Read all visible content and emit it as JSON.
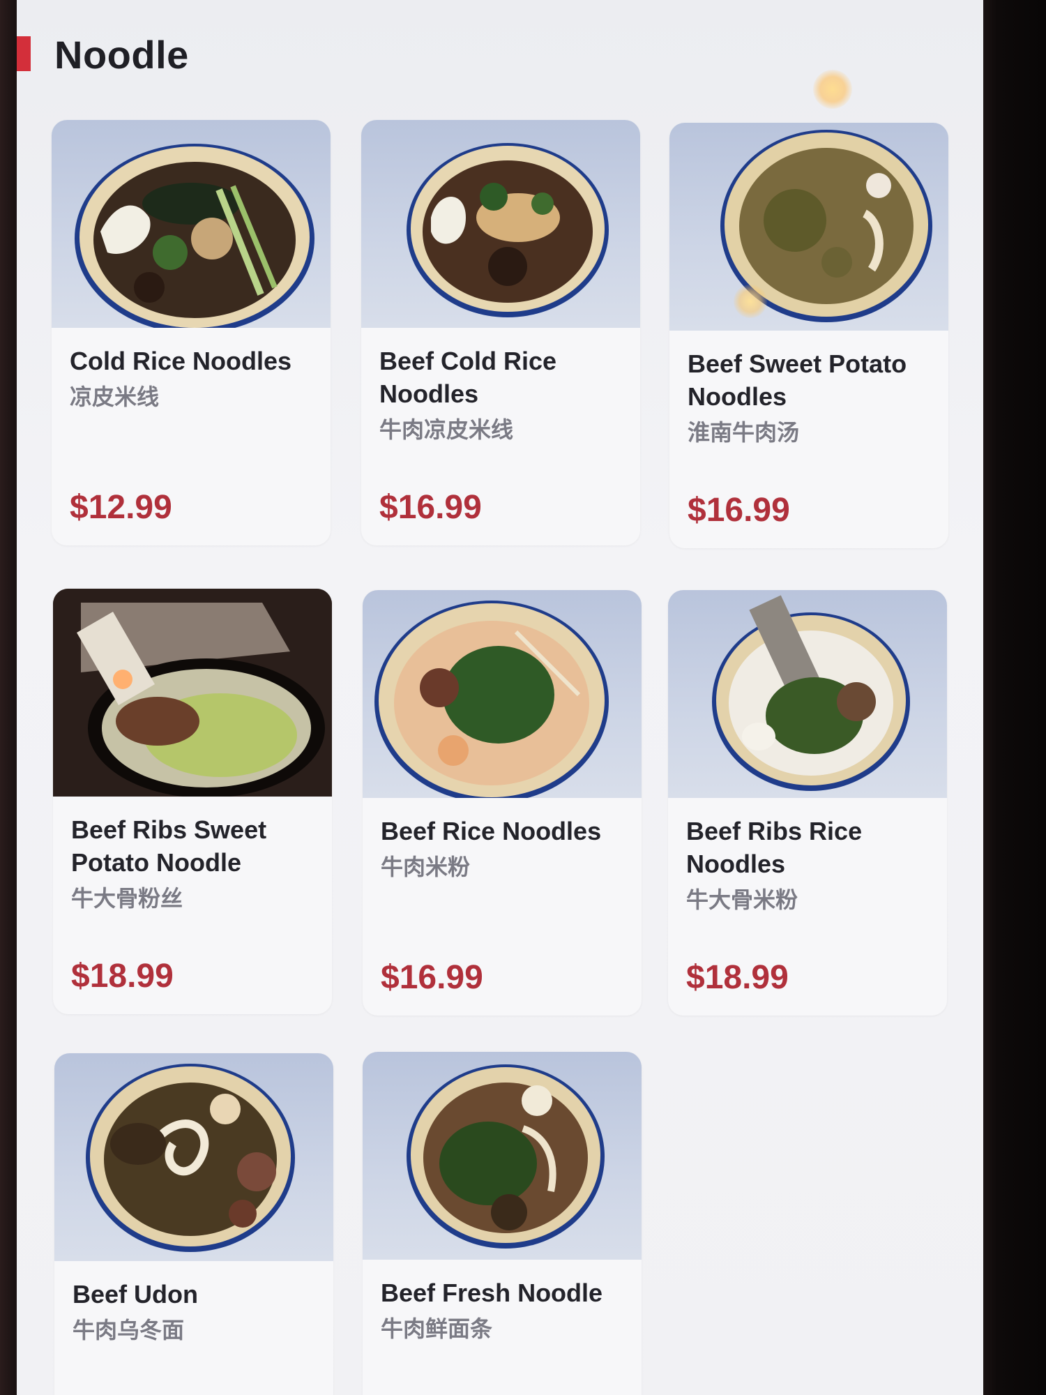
{
  "section": {
    "title": "Noodle",
    "accent_color": "#d32f3a"
  },
  "items": [
    {
      "name": "Cold Rice Noodles",
      "cn": "凉皮米线",
      "price": "$12.99",
      "image_icon": "cold-noodle-bowl-icon"
    },
    {
      "name": "Beef Cold Rice Noodles",
      "cn": "牛肉凉皮米线",
      "price": "$16.99",
      "image_icon": "beef-cold-noodle-bowl-icon"
    },
    {
      "name": "Beef Sweet Potato Noodles",
      "cn": "淮南牛肉汤",
      "price": "$16.99",
      "image_icon": "beef-soup-bowl-icon"
    },
    {
      "name": "Beef Ribs Sweet Potato Noodle",
      "cn": "牛大骨粉丝",
      "price": "$18.99",
      "image_icon": "beef-ribs-bowl-icon"
    },
    {
      "name": "Beef Rice Noodles",
      "cn": "牛肉米粉",
      "price": "$16.99",
      "image_icon": "beef-rice-noodle-bowl-icon"
    },
    {
      "name": "Beef Ribs Rice Noodles",
      "cn": "牛大骨米粉",
      "price": "$18.99",
      "image_icon": "beef-ribs-rice-noodle-bowl-icon"
    },
    {
      "name": "Beef Udon",
      "cn": "牛肉乌冬面",
      "price": "",
      "image_icon": "beef-udon-bowl-icon"
    },
    {
      "name": "Beef Fresh Noodle",
      "cn": "牛肉鲜面条",
      "price": "",
      "image_icon": "beef-fresh-noodle-bowl-icon"
    }
  ],
  "colors": {
    "price": "#b0303b",
    "name": "#23232a",
    "subtitle": "#7a7a84"
  }
}
